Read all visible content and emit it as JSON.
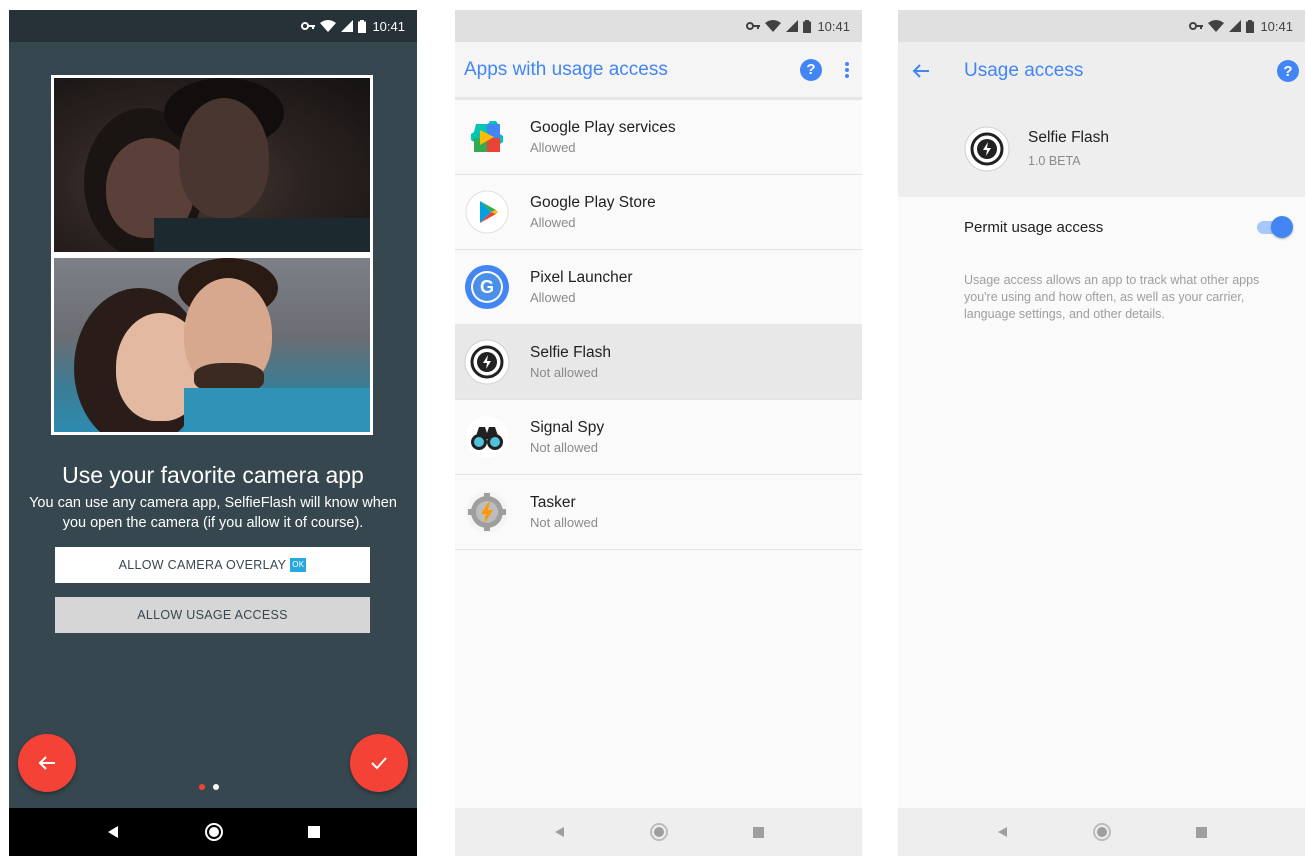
{
  "status_bar": {
    "time": "10:41"
  },
  "screen1": {
    "title": "Use your favorite camera app",
    "description": "You can use any camera app, SelfieFlash will know when you open the camera (if you allow it of course).",
    "allow_overlay_label": "ALLOW CAMERA OVERLAY",
    "ok_badge": "OK",
    "allow_usage_label": "ALLOW USAGE ACCESS",
    "page_indicator": {
      "total": 2,
      "active": 2
    },
    "colors": {
      "background": "#37474f",
      "fab": "#f44336",
      "active_dot": "#ffffff",
      "inactive_dot": "#f44336"
    }
  },
  "screen2": {
    "title": "Apps with usage access",
    "apps": [
      {
        "name": "Google Play services",
        "status": "Allowed",
        "icon": "google-play-services-icon"
      },
      {
        "name": "Google Play Store",
        "status": "Allowed",
        "icon": "google-play-store-icon"
      },
      {
        "name": "Pixel Launcher",
        "status": "Allowed",
        "icon": "pixel-launcher-icon"
      },
      {
        "name": "Selfie Flash",
        "status": "Not allowed",
        "icon": "selfie-flash-icon",
        "selected": true
      },
      {
        "name": "Signal Spy",
        "status": "Not allowed",
        "icon": "signal-spy-icon"
      },
      {
        "name": "Tasker",
        "status": "Not allowed",
        "icon": "tasker-icon"
      }
    ],
    "colors": {
      "accent": "#4285f4"
    }
  },
  "screen3": {
    "title": "Usage access",
    "app_name": "Selfie Flash",
    "app_version": "1.0 BETA",
    "permit_label": "Permit usage access",
    "permit_enabled": true,
    "description": "Usage access allows an app to track what other apps you're using and how often, as well as your carrier, language settings, and other details."
  }
}
